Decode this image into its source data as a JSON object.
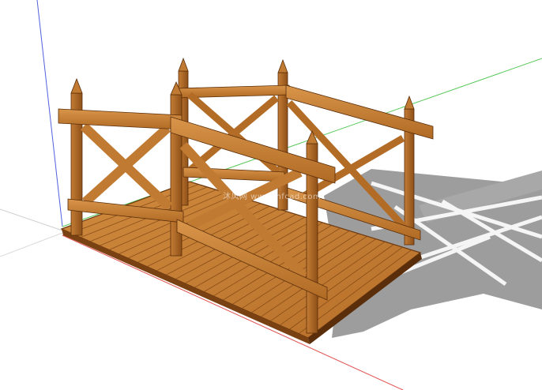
{
  "scene": {
    "subject": "wooden-footbridge",
    "colors": {
      "background": "#ffffff",
      "wood_light": "#d08a3c",
      "wood_mid": "#b66e26",
      "wood_dark": "#7a4212",
      "wood_edge": "#5a2e0a",
      "shadow": "#8c8c8c",
      "axis_red": "#e05050",
      "axis_green": "#5ac85a",
      "axis_blue": "#5060e0"
    },
    "watermark": "沐风网 www.mfcad.com"
  }
}
